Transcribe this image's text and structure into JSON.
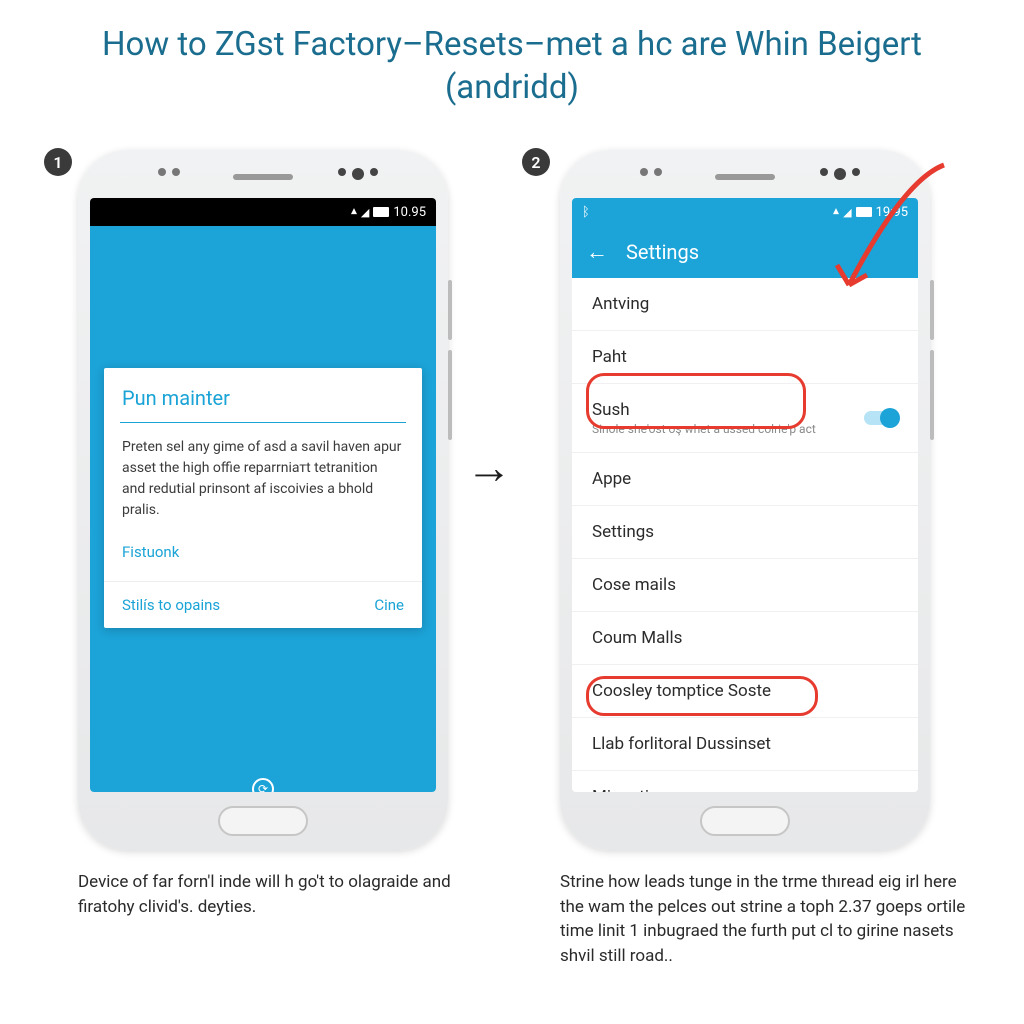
{
  "title": "How to ZGst Factory–Resets–met a hc are Whin Beigert (andridd)",
  "steps": {
    "s1": "1",
    "s2": "2"
  },
  "statusbar": {
    "time1": "10.95",
    "time2": "19:95",
    "bt": "⁂"
  },
  "dialog": {
    "title": "Pun mainter",
    "body": "Preten sel any gime of asd a savil haven apur asset the high offie reparrniатt tetranition and redutial prinsont af iscoivies a bhold pralis.",
    "link": "Fistuonk",
    "left": "Stilís to opains",
    "right": "Cine"
  },
  "appbar": {
    "title": "Settings"
  },
  "list": {
    "i0": "Antving",
    "i1": "Paht",
    "i2": {
      "label": "Sush",
      "sub": "Sinole she'ost оş whet a ussed colrie'p act"
    },
    "i3": "Appe",
    "i4": "Settings",
    "i5": "Cose mails",
    "i6": "Coum Malls",
    "i7": "Coosley tomptice Soste",
    "i8": "Llab forlitoral Dussinset",
    "i9": "Mionation"
  },
  "captions": {
    "c1": "Deviсe of far forn'l inde will h go't to olagraide and firatohy clivid's. deyties.",
    "c2": "Strine how leads tunge in the trme thıread eig irl here the wam the pelces out strine a toph 2.37 goeps ortile time linit 1 inbugraed the furth put cl to girine nasets shvil still road.."
  }
}
